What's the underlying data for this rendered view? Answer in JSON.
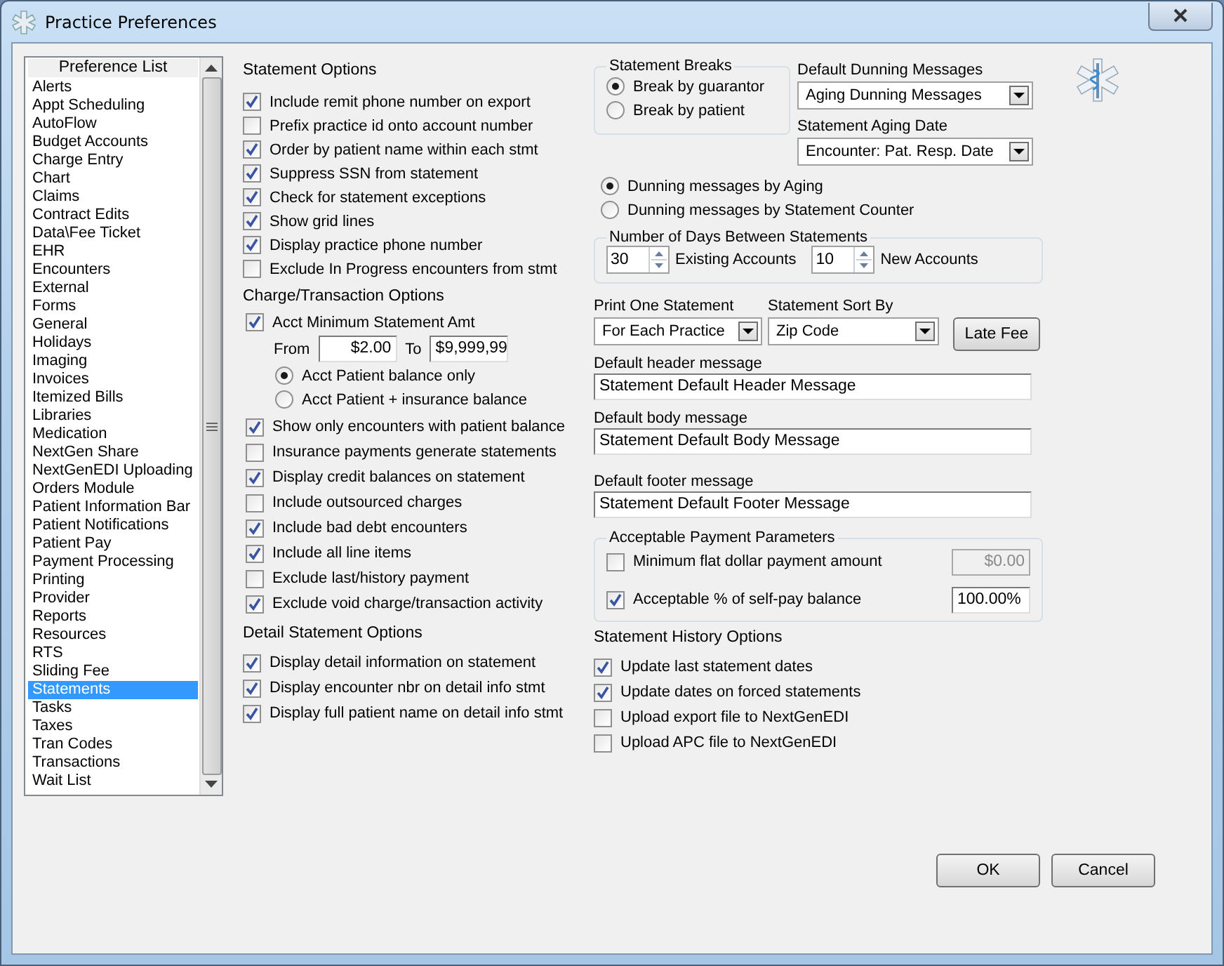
{
  "window": {
    "title": "Practice Preferences"
  },
  "preference_list": {
    "header": "Preference List",
    "items": [
      {
        "label": "Alerts",
        "selected": false
      },
      {
        "label": "Appt Scheduling",
        "selected": false
      },
      {
        "label": "AutoFlow",
        "selected": false
      },
      {
        "label": "Budget Accounts",
        "selected": false
      },
      {
        "label": "Charge Entry",
        "selected": false
      },
      {
        "label": "Chart",
        "selected": false
      },
      {
        "label": "Claims",
        "selected": false
      },
      {
        "label": "Contract Edits",
        "selected": false
      },
      {
        "label": "Data\\Fee Ticket",
        "selected": false
      },
      {
        "label": "EHR",
        "selected": false
      },
      {
        "label": "Encounters",
        "selected": false
      },
      {
        "label": "External",
        "selected": false
      },
      {
        "label": "Forms",
        "selected": false
      },
      {
        "label": "General",
        "selected": false
      },
      {
        "label": "Holidays",
        "selected": false
      },
      {
        "label": "Imaging",
        "selected": false
      },
      {
        "label": "Invoices",
        "selected": false
      },
      {
        "label": "Itemized Bills",
        "selected": false
      },
      {
        "label": "Libraries",
        "selected": false
      },
      {
        "label": "Medication",
        "selected": false
      },
      {
        "label": "NextGen Share",
        "selected": false
      },
      {
        "label": "NextGenEDI Uploading",
        "selected": false
      },
      {
        "label": "Orders Module",
        "selected": false
      },
      {
        "label": "Patient Information Bar",
        "selected": false
      },
      {
        "label": "Patient Notifications",
        "selected": false
      },
      {
        "label": "Patient Pay",
        "selected": false
      },
      {
        "label": "Payment Processing",
        "selected": false
      },
      {
        "label": "Printing",
        "selected": false
      },
      {
        "label": "Provider",
        "selected": false
      },
      {
        "label": "Reports",
        "selected": false
      },
      {
        "label": "Resources",
        "selected": false
      },
      {
        "label": "RTS",
        "selected": false
      },
      {
        "label": "Sliding Fee",
        "selected": false
      },
      {
        "label": "Statements",
        "selected": true
      },
      {
        "label": "Tasks",
        "selected": false
      },
      {
        "label": "Taxes",
        "selected": false
      },
      {
        "label": "Tran Codes",
        "selected": false
      },
      {
        "label": "Transactions",
        "selected": false
      },
      {
        "label": "Wait List",
        "selected": false
      }
    ]
  },
  "statement_options": {
    "title": "Statement Options",
    "items": [
      {
        "label": "Include remit phone number on export",
        "checked": true
      },
      {
        "label": "Prefix practice id onto account number",
        "checked": false
      },
      {
        "label": "Order by patient name within each stmt",
        "checked": true
      },
      {
        "label": "Suppress SSN from statement",
        "checked": true
      },
      {
        "label": "Check for statement exceptions",
        "checked": true
      },
      {
        "label": "Show grid lines",
        "checked": true
      },
      {
        "label": "Display practice phone number",
        "checked": true
      },
      {
        "label": "Exclude In Progress encounters from stmt",
        "checked": false
      }
    ]
  },
  "charge_options": {
    "title": "Charge/Transaction Options",
    "min_amount": {
      "label": "Acct Minimum Statement Amt",
      "checked": true,
      "from_label": "From",
      "from_value": "$2.00",
      "to_label": "To",
      "to_value": "$9,999,99"
    },
    "radios": [
      {
        "label": "Acct Patient balance only",
        "selected": true
      },
      {
        "label": "Acct Patient + insurance balance",
        "selected": false
      }
    ],
    "items": [
      {
        "label": "Show only encounters with patient balance",
        "checked": true
      },
      {
        "label": "Insurance payments generate statements",
        "checked": false
      },
      {
        "label": "Display credit balances on statement",
        "checked": true
      },
      {
        "label": "Include outsourced charges",
        "checked": false
      },
      {
        "label": "Include bad debt encounters",
        "checked": true
      },
      {
        "label": "Include all line items",
        "checked": true
      },
      {
        "label": "Exclude last/history payment",
        "checked": false
      },
      {
        "label": "Exclude void charge/transaction activity",
        "checked": true
      }
    ]
  },
  "detail_options": {
    "title": "Detail Statement Options",
    "items": [
      {
        "label": "Display detail information on statement",
        "checked": true
      },
      {
        "label": "Display encounter nbr on detail info stmt",
        "checked": true
      },
      {
        "label": "Display full patient name on detail info stmt",
        "checked": true
      }
    ]
  },
  "statement_breaks": {
    "title": "Statement Breaks",
    "options": [
      {
        "label": "Break by guarantor",
        "selected": true
      },
      {
        "label": "Break by patient",
        "selected": false
      }
    ]
  },
  "dunning_messages": {
    "label": "Default Dunning Messages",
    "value": "Aging Dunning Messages"
  },
  "aging_date": {
    "label": "Statement Aging Date",
    "value": "Encounter:  Pat. Resp. Date"
  },
  "dunning_mode": [
    {
      "label": "Dunning messages by Aging",
      "selected": true
    },
    {
      "label": "Dunning messages by Statement Counter",
      "selected": false
    }
  ],
  "days_between": {
    "title": "Number of Days Between Statements",
    "existing": {
      "value": "30",
      "label": "Existing Accounts"
    },
    "new": {
      "value": "10",
      "label": "New Accounts"
    }
  },
  "print_one": {
    "label": "Print One Statement",
    "value": "For Each Practice"
  },
  "sort_by": {
    "label": "Statement Sort By",
    "value": "Zip Code"
  },
  "late_fee_button": "Late Fee",
  "messages": [
    {
      "label": "Default header message",
      "value": "Statement Default Header Message"
    },
    {
      "label": "Default body message",
      "value": "Statement Default Body Message"
    },
    {
      "label": "Default footer message",
      "value": "Statement Default Footer Message"
    }
  ],
  "payment_params": {
    "title": "Acceptable Payment Parameters",
    "items": [
      {
        "label": "Minimum flat dollar payment amount",
        "checked": false,
        "value": "$0.00",
        "disabled": true
      },
      {
        "label": "Acceptable % of self-pay balance",
        "checked": true,
        "value": "100.00%",
        "disabled": false
      }
    ]
  },
  "history": {
    "title": "Statement History Options",
    "items": [
      {
        "label": "Update last statement dates",
        "checked": true
      },
      {
        "label": "Update dates on forced statements",
        "checked": true
      },
      {
        "label": "Upload export file to NextGenEDI",
        "checked": false
      },
      {
        "label": "Upload APC file to NextGenEDI",
        "checked": false
      }
    ]
  },
  "buttons": [
    "OK",
    "Cancel"
  ]
}
